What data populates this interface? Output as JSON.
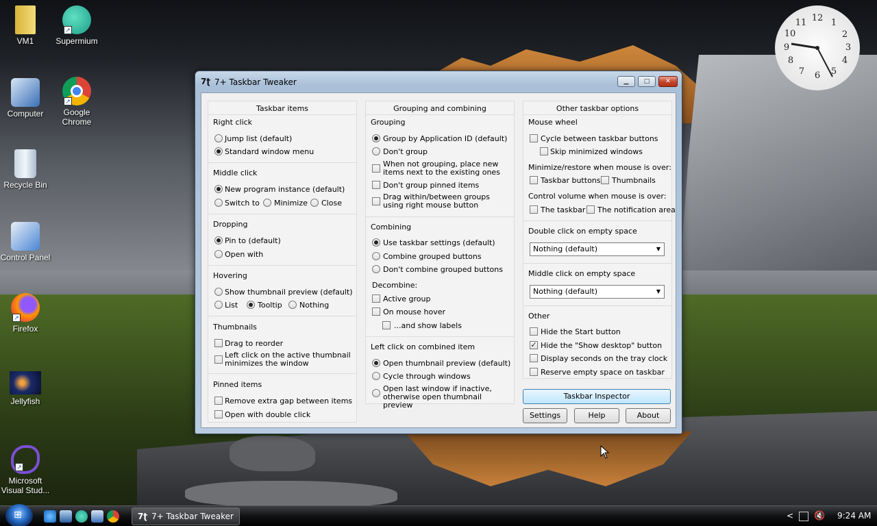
{
  "desktop": {
    "icons": [
      {
        "label": "VM1",
        "icon": "folder-icon"
      },
      {
        "label": "Supermium",
        "icon": "supermium-icon"
      },
      {
        "label": "Computer",
        "icon": "computer-icon"
      },
      {
        "label": "Google Chrome",
        "icon": "chrome-icon"
      },
      {
        "label": "Recycle Bin",
        "icon": "recycle-bin-icon"
      },
      {
        "label": "Control Panel",
        "icon": "control-panel-icon"
      },
      {
        "label": "Firefox",
        "icon": "firefox-icon"
      },
      {
        "label": "Jellyfish",
        "icon": "jellyfish-image-icon"
      },
      {
        "label": "Microsoft Visual Stud...",
        "icon": "visual-studio-icon"
      }
    ],
    "clock_numbers": [
      "12",
      "1",
      "2",
      "3",
      "4",
      "5",
      "6",
      "7",
      "8",
      "9",
      "10",
      "11"
    ]
  },
  "window": {
    "title": "7+ Taskbar Tweaker",
    "title_icon": "7tt-icon",
    "controls": {
      "minimize": "▁",
      "maximize": "□",
      "close": "✕"
    },
    "taskbar_items": {
      "title": "Taskbar items",
      "right_click": {
        "label": "Right click",
        "opt1": "Jump list (default)",
        "opt2": "Standard window menu"
      },
      "middle_click": {
        "label": "Middle click",
        "opt1": "New program instance (default)",
        "opt2": "Switch to",
        "opt3": "Minimize",
        "opt4": "Close"
      },
      "dropping": {
        "label": "Dropping",
        "opt1": "Pin to (default)",
        "opt2": "Open with"
      },
      "hovering": {
        "label": "Hovering",
        "opt1": "Show thumbnail preview (default)",
        "opt2": "List",
        "opt3": "Tooltip",
        "opt4": "Nothing"
      },
      "thumbnails": {
        "label": "Thumbnails",
        "opt1": "Drag to reorder",
        "opt2": "Left click on the active thumbnail minimizes the window"
      },
      "pinned": {
        "label": "Pinned items",
        "opt1": "Remove extra gap between items",
        "opt2": "Open with double click"
      }
    },
    "grouping_combining": {
      "title": "Grouping and combining",
      "grouping": {
        "label": "Grouping",
        "opt1": "Group by Application ID (default)",
        "opt2": "Don't group",
        "opt3": "When not grouping, place new items next to the existing ones",
        "opt4": "Don't group pinned items",
        "opt5": "Drag within/between groups using right mouse button"
      },
      "combining": {
        "label": "Combining",
        "opt1": "Use taskbar settings (default)",
        "opt2": "Combine grouped buttons",
        "opt3": "Don't combine grouped buttons"
      },
      "decombine": {
        "label": "Decombine:",
        "opt1": "Active group",
        "opt2": "On mouse hover",
        "opt3": "...and show labels"
      },
      "left_click": {
        "label": "Left click on combined item",
        "opt1": "Open thumbnail preview (default)",
        "opt2": "Cycle through windows",
        "opt3": "Open last window if inactive, otherwise open thumbnail preview"
      }
    },
    "other_options": {
      "title": "Other taskbar options",
      "mouse_wheel": {
        "label": "Mouse wheel",
        "opt1": "Cycle between taskbar buttons",
        "opt2": "Skip minimized windows"
      },
      "minimize_restore": {
        "label": "Minimize/restore when mouse is over:",
        "opt1": "Taskbar buttons",
        "opt2": "Thumbnails"
      },
      "volume": {
        "label": "Control volume when mouse is over:",
        "opt1": "The taskbar",
        "opt2": "The notification area"
      },
      "dbl_click": {
        "label": "Double click on empty space",
        "value": "Nothing (default)"
      },
      "mid_click": {
        "label": "Middle click on empty space",
        "value": "Nothing (default)"
      },
      "other": {
        "label": "Other",
        "opt1": "Hide the Start button",
        "opt2": "Hide the \"Show desktop\" button",
        "opt3": "Display seconds on the tray clock",
        "opt4": "Reserve empty space on taskbar"
      }
    },
    "buttons": {
      "inspector": "Taskbar Inspector",
      "settings": "Settings",
      "help": "Help",
      "about": "About"
    }
  },
  "taskbar": {
    "active_task": "7+ Taskbar Tweaker",
    "task_icon": "7tt-icon",
    "time": "9:24 AM",
    "chevron": "<",
    "colors": {
      "accent": "#3c7fb1"
    }
  }
}
